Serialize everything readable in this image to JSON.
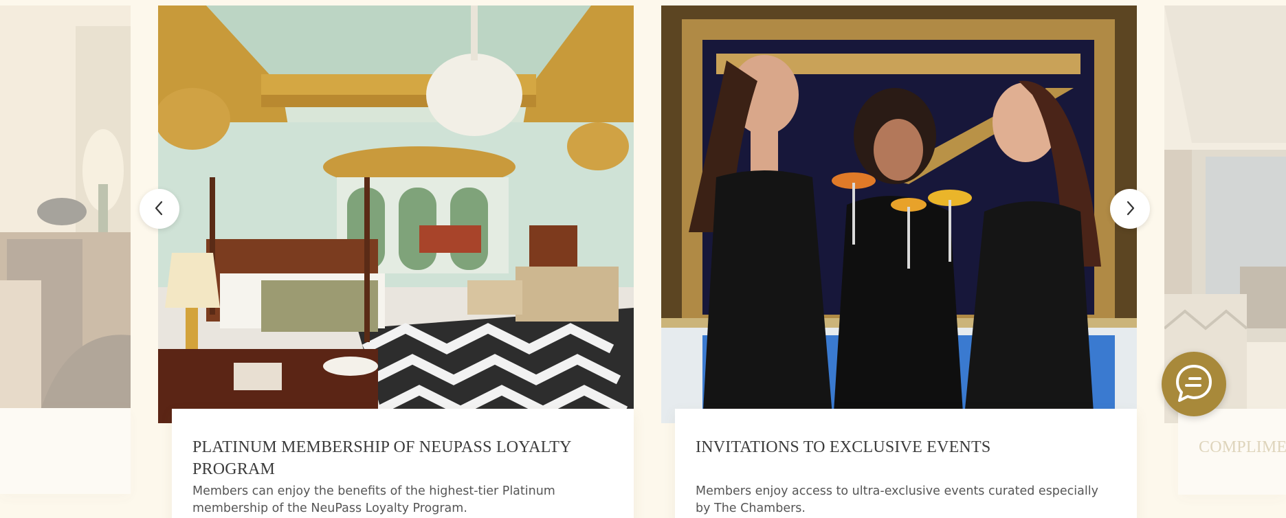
{
  "carousel": {
    "cards": [
      {
        "title": "",
        "description": ""
      },
      {
        "title": "PLATINUM MEMBERSHIP OF NEUPASS LOYALTY PROGRAM",
        "description": "Members can enjoy the benefits of the highest-tier Platinum membership of the NeuPass Loyalty Program."
      },
      {
        "title": "INVITATIONS TO EXCLUSIVE EVENTS",
        "description": "Members enjoy access to ultra-exclusive events curated especially by The Chambers."
      },
      {
        "title": "COMPLIMEN",
        "description": ""
      }
    ],
    "prev_icon": "chevron-left-icon",
    "next_icon": "chevron-right-icon"
  },
  "chat": {
    "icon": "chat-bubble-icon"
  },
  "colors": {
    "page_background": "#fdf8ec",
    "accent_gold": "#a8893a",
    "title_text": "#3b3b3b",
    "body_text": "#555555"
  }
}
